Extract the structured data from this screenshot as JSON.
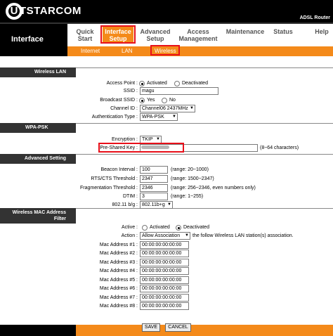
{
  "brand": {
    "logo_letter": "U",
    "logo_text": "TSTARCOM",
    "model": "ADSL Router"
  },
  "left_title": "Interface",
  "nav": [
    {
      "line1": "Quick",
      "line2": "Start"
    },
    {
      "line1": "Interface",
      "line2": "Setup"
    },
    {
      "line1": "Advanced",
      "line2": "Setup"
    },
    {
      "line1": "Access",
      "line2": "Management"
    },
    {
      "line1": "Maintenance",
      "line2": ""
    },
    {
      "line1": "Status",
      "line2": ""
    },
    {
      "line1": "Help",
      "line2": ""
    }
  ],
  "subnav": [
    "Internet",
    "LAN",
    "Wireless"
  ],
  "sections": {
    "wireless_lan": "Wireless LAN",
    "wpa_psk": "WPA-PSK",
    "advanced": "Advanced Setting",
    "mac_filter_1": "Wireless MAC Address",
    "mac_filter_2": "Filter"
  },
  "wlan": {
    "access_point_label": "Access Point :",
    "activated": "Activated",
    "deactivated": "Deactivated",
    "ssid_label": "SSID :",
    "ssid_value": "magu",
    "broadcast_label": "Broadcast SSID :",
    "yes": "Yes",
    "no": "No",
    "channel_label": "Channel ID :",
    "channel_value": "Channel06 2437MHz",
    "auth_label": "Authentication Type :",
    "auth_value": "WPA-PSK"
  },
  "wpa": {
    "encryption_label": "Encryption :",
    "encryption_value": "TKIP",
    "psk_label": "Pre-Shared Key :",
    "psk_hint": "(8~64 characters)"
  },
  "adv": {
    "beacon_label": "Beacon Interval :",
    "beacon_value": "100",
    "beacon_hint": "(range: 20~1000)",
    "rts_label": "RTS/CTS Threshold :",
    "rts_value": "2347",
    "rts_hint": "(range: 1500~2347)",
    "frag_label": "Fragmentation Threshold :",
    "frag_value": "2346",
    "frag_hint": "(range: 256~2346, even numbers only)",
    "dtim_label": "DTIM :",
    "dtim_value": "3",
    "dtim_hint": "(range: 1~255)",
    "mode_label": "802.11 b/g :",
    "mode_value": "802.11b+g"
  },
  "mac": {
    "active_label": "Active :",
    "activated": "Activated",
    "deactivated": "Deactivated",
    "action_label": "Action :",
    "action_value": "Allow Association",
    "action_suffix": "the follow Wireless LAN station(s) association.",
    "addresses": [
      {
        "label": "Mac Address #1 :",
        "value": "00:00:00:00:00:00"
      },
      {
        "label": "Mac Address #2 :",
        "value": "00:00:00:00:00:00"
      },
      {
        "label": "Mac Address #3 :",
        "value": "00:00:00:00:00:00"
      },
      {
        "label": "Mac Address #4 :",
        "value": "00:00:00:00:00:00"
      },
      {
        "label": "Mac Address #5 :",
        "value": "00:00:00:00:00:00"
      },
      {
        "label": "Mac Address #6 :",
        "value": "00:00:00:00:00:00"
      },
      {
        "label": "Mac Address #7 :",
        "value": "00:00:00:00:00:00"
      },
      {
        "label": "Mac Address #8 :",
        "value": "00:00:00:00:00:00"
      }
    ]
  },
  "buttons": {
    "save": "SAVE",
    "cancel": "CANCEL"
  },
  "colors": {
    "accent": "#f48a1a",
    "highlight": "#e8101a",
    "header": "#000000"
  }
}
